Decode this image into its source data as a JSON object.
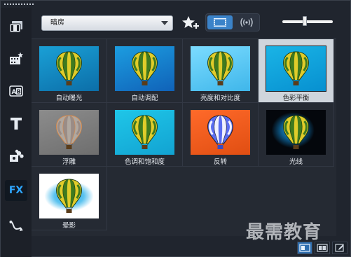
{
  "toolbar": {
    "dropdown_value": "暗房"
  },
  "slider": {
    "value": 0.45
  },
  "filters": [
    {
      "label": "自动曝光",
      "bg1": "#1aa0d6",
      "bg2": "#0c6ea8",
      "selected": false
    },
    {
      "label": "自动调配",
      "bg1": "#1c9de0",
      "bg2": "#1062b8",
      "selected": false
    },
    {
      "label": "亮度和对比度",
      "bg1": "#7cdcff",
      "bg2": "#3fb6ea",
      "selected": false
    },
    {
      "label": "色彩平衡",
      "bg1": "#1ab4e6",
      "bg2": "#0790d0",
      "selected": true
    },
    {
      "label": "浮雕",
      "bg1": "#8c8c8c",
      "bg2": "#6e6e6e",
      "selected": false
    },
    {
      "label": "色调和饱和度",
      "bg1": "#1fc6e8",
      "bg2": "#12a3d2",
      "selected": false
    },
    {
      "label": "反转",
      "bg1": "#ff6a2a",
      "bg2": "#e04e12",
      "selected": false
    },
    {
      "label": "光线",
      "bg1": "#0a0f1a",
      "bg2": "#050810",
      "selected": false
    },
    {
      "label": "晕影",
      "bg1": "#ffffff",
      "bg2": "#e8f2f8",
      "selected": false
    }
  ],
  "watermark": "最需教育",
  "icons": {
    "sidebar": [
      "media-icon",
      "instant-project-icon",
      "title-template-icon",
      "text-icon",
      "graphics-icon",
      "fx-icon",
      "path-icon"
    ]
  }
}
